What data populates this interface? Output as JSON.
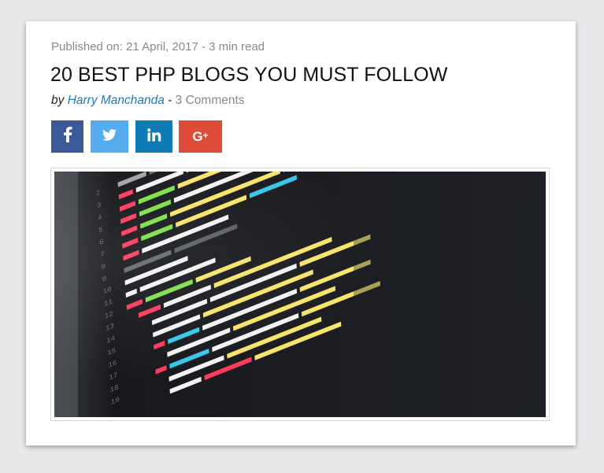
{
  "post": {
    "published": "Published on: 21 April, 2017 - 3 min read",
    "title": "20 BEST PHP BLOGS YOU MUST FOLLOW",
    "by_label": "by",
    "author": "Harry Manchanda",
    "separator": " - ",
    "comments": "3 Comments"
  },
  "share": [
    {
      "network": "facebook",
      "icon": "facebook-icon",
      "glyph": "f",
      "color": "#3b5998"
    },
    {
      "network": "twitter",
      "icon": "twitter-icon",
      "glyph": "twitter-bird",
      "color": "#55acee"
    },
    {
      "network": "linkedin",
      "icon": "linkedin-icon",
      "glyph": "in",
      "color": "#0f7bb5"
    },
    {
      "network": "google-plus",
      "icon": "google-plus-icon",
      "glyph": "G+",
      "color": "#dd4b39"
    }
  ],
  "image": {
    "description_icon": "code-editor-photo"
  },
  "colors": {
    "page_bg": "#e9e9ec",
    "link": "#1e79c0",
    "muted": "#8a8a8a"
  }
}
